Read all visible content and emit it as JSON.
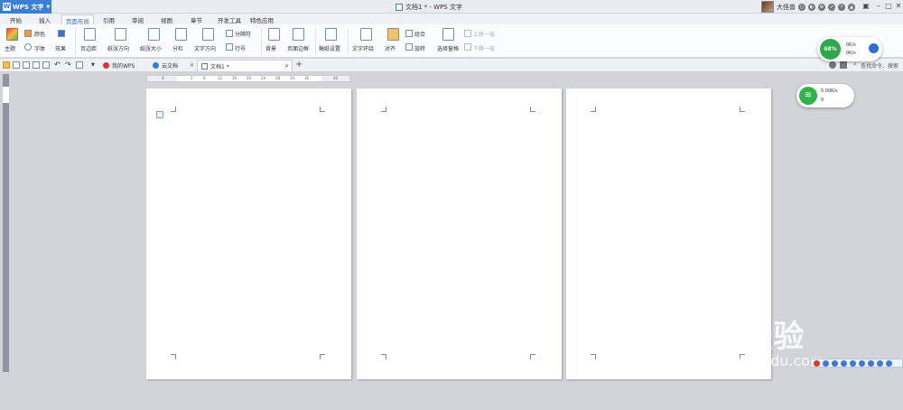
{
  "app": {
    "name": "WPS 文字",
    "doc_title": "文档1 * - WPS 文字",
    "user_name": "大怪兽"
  },
  "menu_tabs": [
    {
      "label": "开始"
    },
    {
      "label": "插入"
    },
    {
      "label": "页面布局"
    },
    {
      "label": "引用"
    },
    {
      "label": "审阅"
    },
    {
      "label": "视图"
    },
    {
      "label": "章节"
    },
    {
      "label": "开发工具"
    },
    {
      "label": "特色应用"
    }
  ],
  "ribbon": {
    "theme": "主题",
    "colors": "颜色",
    "fonts": "字体",
    "effects": "效果",
    "margins": "页边距",
    "orientation": "纸张方向",
    "size": "纸张大小",
    "columns": "分栏",
    "text_direction": "文字方向",
    "breaks": "分隔符",
    "line_numbers": "行号",
    "background": "背景",
    "page_borders": "页面边框",
    "manuscript": "稿纸设置",
    "wrap": "文字环绕",
    "align": "对齐",
    "rotate": "旋转",
    "group": "组合",
    "selection_pane": "选择窗格",
    "bring_forward": "上移一层",
    "send_backward": "下移一层"
  },
  "search": {
    "placeholder": "查找命令、搜索"
  },
  "doc_tabs": [
    {
      "label": "我的WPS"
    },
    {
      "label": "云文档"
    },
    {
      "label": "文档1 *"
    }
  ],
  "ruler": {
    "marks": [
      "4",
      "2",
      "2",
      "4",
      "8",
      "10",
      "12",
      "16",
      "18",
      "20",
      "24",
      "26",
      "28",
      "32",
      "34",
      "36",
      "38",
      "40"
    ]
  },
  "speed_ball": {
    "percent": "68%",
    "up": "0K/s",
    "down": "0K/s"
  },
  "wifi_widget": {
    "speed": "5.00K/s",
    "count": "0"
  },
  "watermark": {
    "brand": "Bai  经验",
    "site": "jingyan.baidu.com"
  }
}
